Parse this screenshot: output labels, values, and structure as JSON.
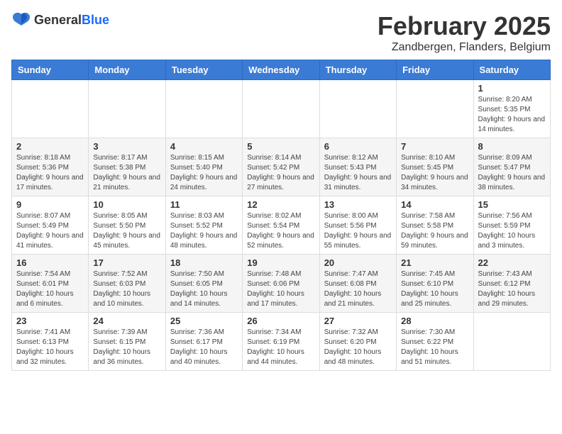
{
  "logo": {
    "general": "General",
    "blue": "Blue"
  },
  "header": {
    "title": "February 2025",
    "subtitle": "Zandbergen, Flanders, Belgium"
  },
  "weekdays": [
    "Sunday",
    "Monday",
    "Tuesday",
    "Wednesday",
    "Thursday",
    "Friday",
    "Saturday"
  ],
  "weeks": [
    [
      {
        "day": "",
        "info": ""
      },
      {
        "day": "",
        "info": ""
      },
      {
        "day": "",
        "info": ""
      },
      {
        "day": "",
        "info": ""
      },
      {
        "day": "",
        "info": ""
      },
      {
        "day": "",
        "info": ""
      },
      {
        "day": "1",
        "info": "Sunrise: 8:20 AM\nSunset: 5:35 PM\nDaylight: 9 hours and 14 minutes."
      }
    ],
    [
      {
        "day": "2",
        "info": "Sunrise: 8:18 AM\nSunset: 5:36 PM\nDaylight: 9 hours and 17 minutes."
      },
      {
        "day": "3",
        "info": "Sunrise: 8:17 AM\nSunset: 5:38 PM\nDaylight: 9 hours and 21 minutes."
      },
      {
        "day": "4",
        "info": "Sunrise: 8:15 AM\nSunset: 5:40 PM\nDaylight: 9 hours and 24 minutes."
      },
      {
        "day": "5",
        "info": "Sunrise: 8:14 AM\nSunset: 5:42 PM\nDaylight: 9 hours and 27 minutes."
      },
      {
        "day": "6",
        "info": "Sunrise: 8:12 AM\nSunset: 5:43 PM\nDaylight: 9 hours and 31 minutes."
      },
      {
        "day": "7",
        "info": "Sunrise: 8:10 AM\nSunset: 5:45 PM\nDaylight: 9 hours and 34 minutes."
      },
      {
        "day": "8",
        "info": "Sunrise: 8:09 AM\nSunset: 5:47 PM\nDaylight: 9 hours and 38 minutes."
      }
    ],
    [
      {
        "day": "9",
        "info": "Sunrise: 8:07 AM\nSunset: 5:49 PM\nDaylight: 9 hours and 41 minutes."
      },
      {
        "day": "10",
        "info": "Sunrise: 8:05 AM\nSunset: 5:50 PM\nDaylight: 9 hours and 45 minutes."
      },
      {
        "day": "11",
        "info": "Sunrise: 8:03 AM\nSunset: 5:52 PM\nDaylight: 9 hours and 48 minutes."
      },
      {
        "day": "12",
        "info": "Sunrise: 8:02 AM\nSunset: 5:54 PM\nDaylight: 9 hours and 52 minutes."
      },
      {
        "day": "13",
        "info": "Sunrise: 8:00 AM\nSunset: 5:56 PM\nDaylight: 9 hours and 55 minutes."
      },
      {
        "day": "14",
        "info": "Sunrise: 7:58 AM\nSunset: 5:58 PM\nDaylight: 9 hours and 59 minutes."
      },
      {
        "day": "15",
        "info": "Sunrise: 7:56 AM\nSunset: 5:59 PM\nDaylight: 10 hours and 3 minutes."
      }
    ],
    [
      {
        "day": "16",
        "info": "Sunrise: 7:54 AM\nSunset: 6:01 PM\nDaylight: 10 hours and 6 minutes."
      },
      {
        "day": "17",
        "info": "Sunrise: 7:52 AM\nSunset: 6:03 PM\nDaylight: 10 hours and 10 minutes."
      },
      {
        "day": "18",
        "info": "Sunrise: 7:50 AM\nSunset: 6:05 PM\nDaylight: 10 hours and 14 minutes."
      },
      {
        "day": "19",
        "info": "Sunrise: 7:48 AM\nSunset: 6:06 PM\nDaylight: 10 hours and 17 minutes."
      },
      {
        "day": "20",
        "info": "Sunrise: 7:47 AM\nSunset: 6:08 PM\nDaylight: 10 hours and 21 minutes."
      },
      {
        "day": "21",
        "info": "Sunrise: 7:45 AM\nSunset: 6:10 PM\nDaylight: 10 hours and 25 minutes."
      },
      {
        "day": "22",
        "info": "Sunrise: 7:43 AM\nSunset: 6:12 PM\nDaylight: 10 hours and 29 minutes."
      }
    ],
    [
      {
        "day": "23",
        "info": "Sunrise: 7:41 AM\nSunset: 6:13 PM\nDaylight: 10 hours and 32 minutes."
      },
      {
        "day": "24",
        "info": "Sunrise: 7:39 AM\nSunset: 6:15 PM\nDaylight: 10 hours and 36 minutes."
      },
      {
        "day": "25",
        "info": "Sunrise: 7:36 AM\nSunset: 6:17 PM\nDaylight: 10 hours and 40 minutes."
      },
      {
        "day": "26",
        "info": "Sunrise: 7:34 AM\nSunset: 6:19 PM\nDaylight: 10 hours and 44 minutes."
      },
      {
        "day": "27",
        "info": "Sunrise: 7:32 AM\nSunset: 6:20 PM\nDaylight: 10 hours and 48 minutes."
      },
      {
        "day": "28",
        "info": "Sunrise: 7:30 AM\nSunset: 6:22 PM\nDaylight: 10 hours and 51 minutes."
      },
      {
        "day": "",
        "info": ""
      }
    ]
  ]
}
